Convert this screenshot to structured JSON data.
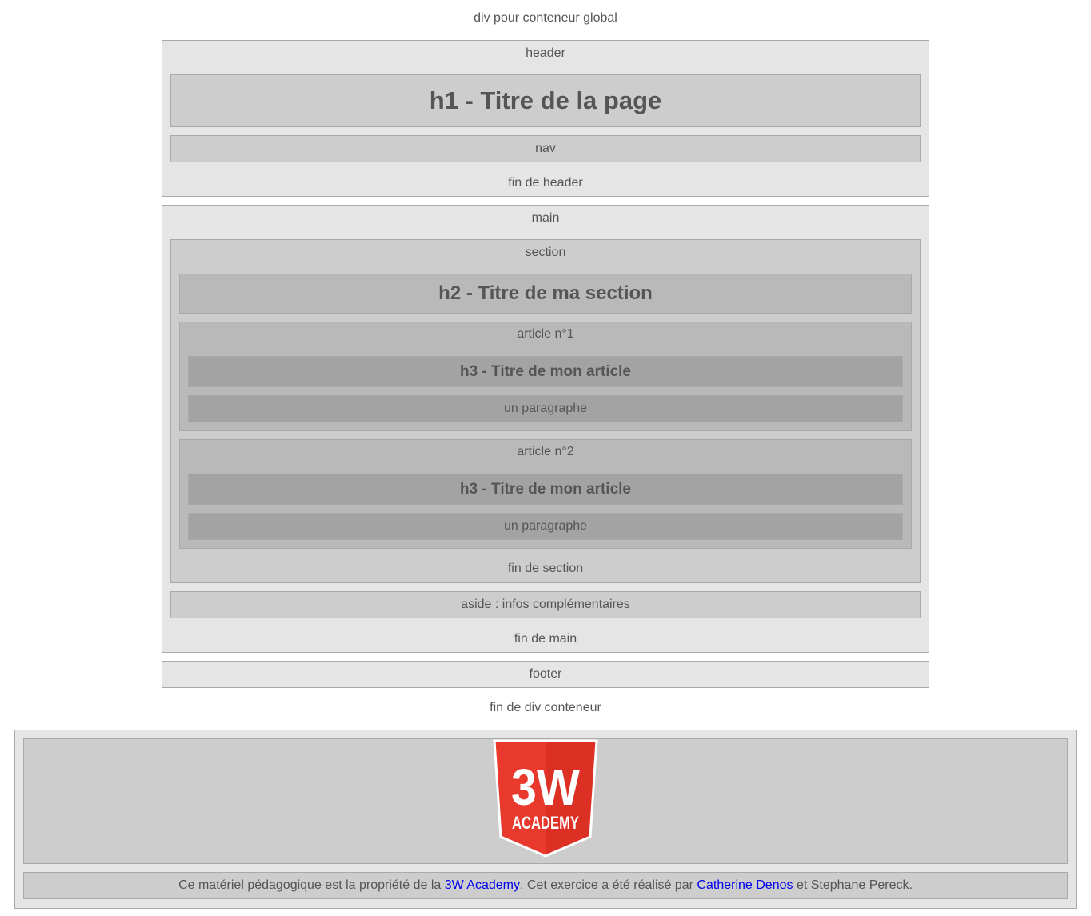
{
  "container": {
    "start_label": "div pour conteneur global",
    "end_label": "fin de div conteneur"
  },
  "header": {
    "label": "header",
    "h1": "h1 - Titre de la page",
    "nav": "nav",
    "end_label": "fin de header"
  },
  "main": {
    "label": "main",
    "end_label": "fin de main",
    "section": {
      "label": "section",
      "h2": "h2 - Titre de ma section",
      "end_label": "fin de section",
      "articles": [
        {
          "label": "article n°1",
          "h3": "h3 - Titre de mon article",
          "paragraph": "un paragraphe"
        },
        {
          "label": "article n°2",
          "h3": "h3 - Titre de mon article",
          "paragraph": "un paragraphe"
        }
      ]
    },
    "aside": "aside : infos complémentaires"
  },
  "footer": {
    "label": "footer"
  },
  "credits": {
    "logo": {
      "big": "3W",
      "small": "ACADEMY",
      "color": "#e8392c",
      "color_dark": "#d12a20"
    },
    "text_before": "Ce matériel pédagogique est la propriété de la ",
    "link1": "3W Academy",
    "text_middle": ". Cet exercice a été réalisé par ",
    "link2": "Catherine Denos",
    "text_after": " et Stephane Pereck."
  }
}
